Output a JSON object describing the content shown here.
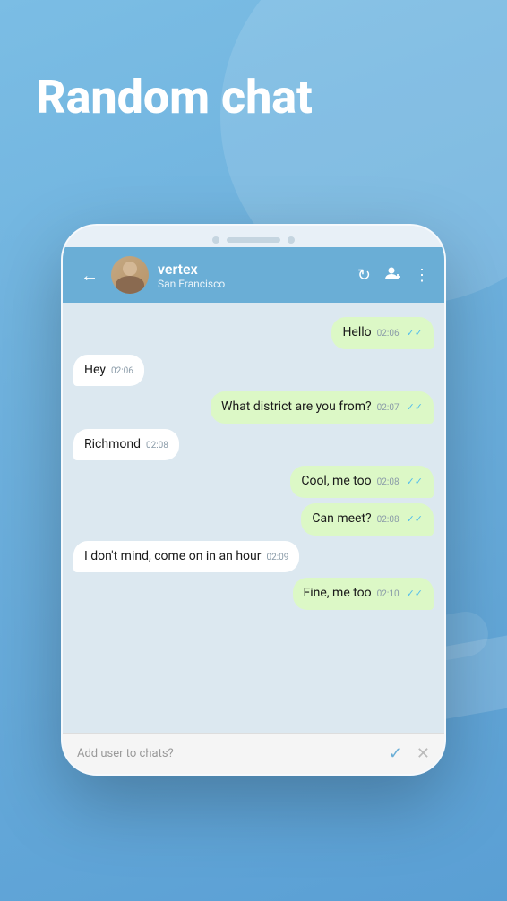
{
  "page": {
    "title": "Random chat",
    "background_color": "#6aaed6"
  },
  "header": {
    "back_label": "←",
    "contact_name": "vertex",
    "contact_location": "San Francisco",
    "refresh_icon": "↻",
    "add_user_icon": "⊕",
    "more_icon": "⋮"
  },
  "messages": [
    {
      "id": 1,
      "side": "right",
      "text": "Hello",
      "time": "02:06",
      "ticks": "✓✓"
    },
    {
      "id": 2,
      "side": "left",
      "text": "Hey",
      "time": "02:06",
      "ticks": ""
    },
    {
      "id": 3,
      "side": "right",
      "text": "What district are you from?",
      "time": "02:07",
      "ticks": "✓✓"
    },
    {
      "id": 4,
      "side": "left",
      "text": "Richmond",
      "time": "02:08",
      "ticks": ""
    },
    {
      "id": 5,
      "side": "right",
      "text": "Cool, me too",
      "time": "02:08",
      "ticks": "✓✓"
    },
    {
      "id": 6,
      "side": "right",
      "text": "Can meet?",
      "time": "02:08",
      "ticks": "✓✓"
    },
    {
      "id": 7,
      "side": "left",
      "text": "I don't mind, come on in an hour",
      "time": "02:09",
      "ticks": ""
    },
    {
      "id": 8,
      "side": "right",
      "text": "Fine, me too",
      "time": "02:10",
      "ticks": "✓✓"
    }
  ],
  "bottom_bar": {
    "prompt": "Add user to chats?",
    "confirm_icon": "✓",
    "close_icon": "✕"
  }
}
